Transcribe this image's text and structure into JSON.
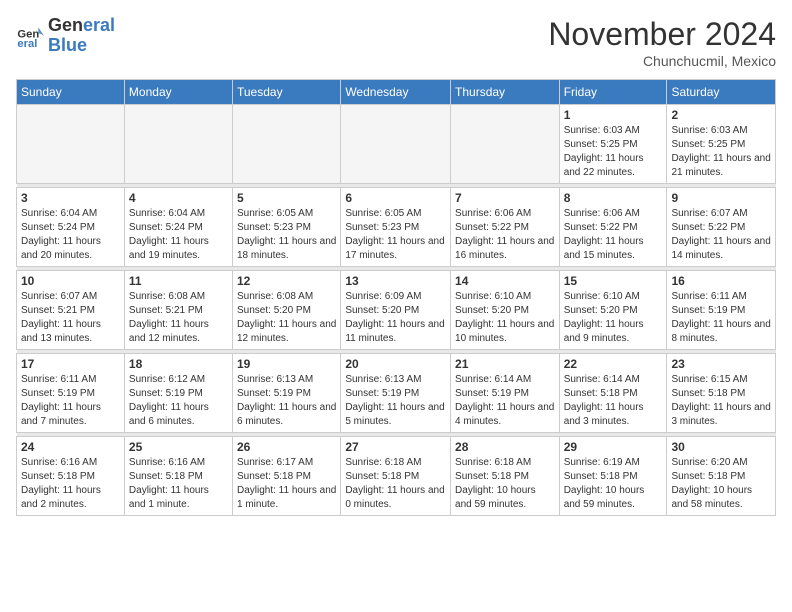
{
  "header": {
    "logo_line1": "General",
    "logo_line2": "Blue",
    "month_title": "November 2024",
    "location": "Chunchucmil, Mexico"
  },
  "weekdays": [
    "Sunday",
    "Monday",
    "Tuesday",
    "Wednesday",
    "Thursday",
    "Friday",
    "Saturday"
  ],
  "weeks": [
    [
      {
        "day": "",
        "info": ""
      },
      {
        "day": "",
        "info": ""
      },
      {
        "day": "",
        "info": ""
      },
      {
        "day": "",
        "info": ""
      },
      {
        "day": "",
        "info": ""
      },
      {
        "day": "1",
        "info": "Sunrise: 6:03 AM\nSunset: 5:25 PM\nDaylight: 11 hours and 22 minutes."
      },
      {
        "day": "2",
        "info": "Sunrise: 6:03 AM\nSunset: 5:25 PM\nDaylight: 11 hours and 21 minutes."
      }
    ],
    [
      {
        "day": "3",
        "info": "Sunrise: 6:04 AM\nSunset: 5:24 PM\nDaylight: 11 hours and 20 minutes."
      },
      {
        "day": "4",
        "info": "Sunrise: 6:04 AM\nSunset: 5:24 PM\nDaylight: 11 hours and 19 minutes."
      },
      {
        "day": "5",
        "info": "Sunrise: 6:05 AM\nSunset: 5:23 PM\nDaylight: 11 hours and 18 minutes."
      },
      {
        "day": "6",
        "info": "Sunrise: 6:05 AM\nSunset: 5:23 PM\nDaylight: 11 hours and 17 minutes."
      },
      {
        "day": "7",
        "info": "Sunrise: 6:06 AM\nSunset: 5:22 PM\nDaylight: 11 hours and 16 minutes."
      },
      {
        "day": "8",
        "info": "Sunrise: 6:06 AM\nSunset: 5:22 PM\nDaylight: 11 hours and 15 minutes."
      },
      {
        "day": "9",
        "info": "Sunrise: 6:07 AM\nSunset: 5:22 PM\nDaylight: 11 hours and 14 minutes."
      }
    ],
    [
      {
        "day": "10",
        "info": "Sunrise: 6:07 AM\nSunset: 5:21 PM\nDaylight: 11 hours and 13 minutes."
      },
      {
        "day": "11",
        "info": "Sunrise: 6:08 AM\nSunset: 5:21 PM\nDaylight: 11 hours and 12 minutes."
      },
      {
        "day": "12",
        "info": "Sunrise: 6:08 AM\nSunset: 5:20 PM\nDaylight: 11 hours and 12 minutes."
      },
      {
        "day": "13",
        "info": "Sunrise: 6:09 AM\nSunset: 5:20 PM\nDaylight: 11 hours and 11 minutes."
      },
      {
        "day": "14",
        "info": "Sunrise: 6:10 AM\nSunset: 5:20 PM\nDaylight: 11 hours and 10 minutes."
      },
      {
        "day": "15",
        "info": "Sunrise: 6:10 AM\nSunset: 5:20 PM\nDaylight: 11 hours and 9 minutes."
      },
      {
        "day": "16",
        "info": "Sunrise: 6:11 AM\nSunset: 5:19 PM\nDaylight: 11 hours and 8 minutes."
      }
    ],
    [
      {
        "day": "17",
        "info": "Sunrise: 6:11 AM\nSunset: 5:19 PM\nDaylight: 11 hours and 7 minutes."
      },
      {
        "day": "18",
        "info": "Sunrise: 6:12 AM\nSunset: 5:19 PM\nDaylight: 11 hours and 6 minutes."
      },
      {
        "day": "19",
        "info": "Sunrise: 6:13 AM\nSunset: 5:19 PM\nDaylight: 11 hours and 6 minutes."
      },
      {
        "day": "20",
        "info": "Sunrise: 6:13 AM\nSunset: 5:19 PM\nDaylight: 11 hours and 5 minutes."
      },
      {
        "day": "21",
        "info": "Sunrise: 6:14 AM\nSunset: 5:19 PM\nDaylight: 11 hours and 4 minutes."
      },
      {
        "day": "22",
        "info": "Sunrise: 6:14 AM\nSunset: 5:18 PM\nDaylight: 11 hours and 3 minutes."
      },
      {
        "day": "23",
        "info": "Sunrise: 6:15 AM\nSunset: 5:18 PM\nDaylight: 11 hours and 3 minutes."
      }
    ],
    [
      {
        "day": "24",
        "info": "Sunrise: 6:16 AM\nSunset: 5:18 PM\nDaylight: 11 hours and 2 minutes."
      },
      {
        "day": "25",
        "info": "Sunrise: 6:16 AM\nSunset: 5:18 PM\nDaylight: 11 hours and 1 minute."
      },
      {
        "day": "26",
        "info": "Sunrise: 6:17 AM\nSunset: 5:18 PM\nDaylight: 11 hours and 1 minute."
      },
      {
        "day": "27",
        "info": "Sunrise: 6:18 AM\nSunset: 5:18 PM\nDaylight: 11 hours and 0 minutes."
      },
      {
        "day": "28",
        "info": "Sunrise: 6:18 AM\nSunset: 5:18 PM\nDaylight: 10 hours and 59 minutes."
      },
      {
        "day": "29",
        "info": "Sunrise: 6:19 AM\nSunset: 5:18 PM\nDaylight: 10 hours and 59 minutes."
      },
      {
        "day": "30",
        "info": "Sunrise: 6:20 AM\nSunset: 5:18 PM\nDaylight: 10 hours and 58 minutes."
      }
    ]
  ]
}
